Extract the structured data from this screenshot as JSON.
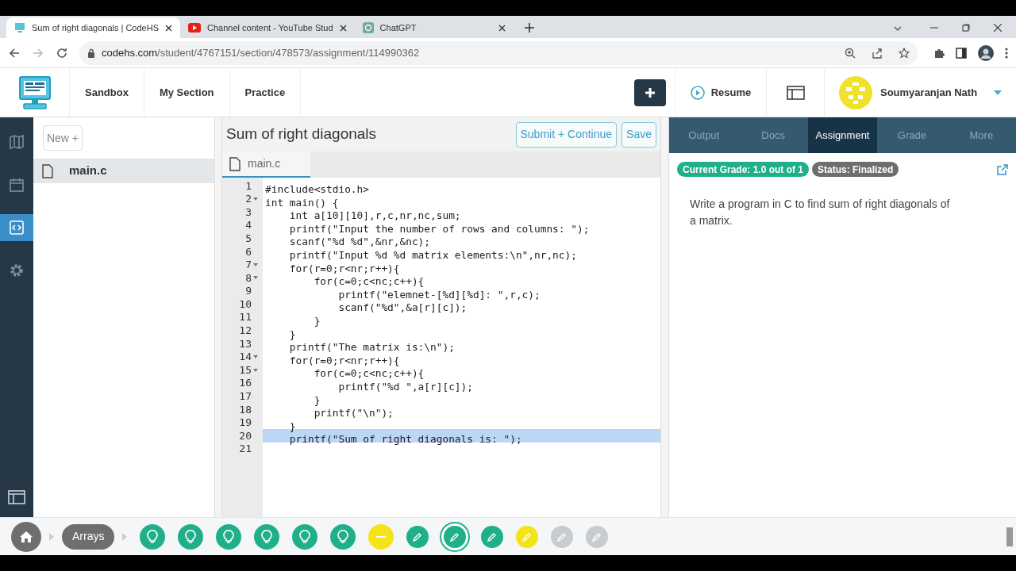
{
  "browser": {
    "tabs": [
      {
        "title": "Sum of right diagonals | CodeHS",
        "selected": true,
        "kind": "codehs"
      },
      {
        "title": "Channel content - YouTube Stud",
        "selected": false,
        "kind": "youtube"
      },
      {
        "title": "ChatGPT",
        "selected": false,
        "kind": "chatgpt"
      }
    ],
    "url_host": "codehs.com",
    "url_path": "/student/4767151/section/478573/assignment/114990362"
  },
  "nav": {
    "items": [
      "Sandbox",
      "My Section",
      "Practice"
    ],
    "resume": "Resume",
    "user": "Soumyaranjan Nath"
  },
  "rail": [
    {
      "kind": "map",
      "selected": false
    },
    {
      "kind": "calendar",
      "selected": false
    },
    {
      "kind": "code",
      "selected": true
    },
    {
      "kind": "gear",
      "selected": false
    }
  ],
  "files": {
    "new_button": "New +",
    "items": [
      {
        "name": "main.c",
        "selected": true
      }
    ]
  },
  "editor": {
    "title": "Sum of right diagonals",
    "buttons": [
      "Submit + Continue",
      "Save"
    ],
    "tab": "main.c",
    "lines": [
      {
        "num": "1",
        "text": "#include<stdio.h>",
        "foldable": false,
        "highlighted": false
      },
      {
        "num": "2",
        "text": "int main() {",
        "foldable": true,
        "highlighted": false
      },
      {
        "num": "3",
        "text": "    int a[10][10],r,c,nr,nc,sum;",
        "foldable": false,
        "highlighted": false
      },
      {
        "num": "4",
        "text": "    printf(\"Input the number of rows and columns: \");",
        "foldable": false,
        "highlighted": false
      },
      {
        "num": "5",
        "text": "    scanf(\"%d %d\",&nr,&nc);",
        "foldable": false,
        "highlighted": false
      },
      {
        "num": "6",
        "text": "    printf(\"Input %d %d matrix elements:\\n\",nr,nc);",
        "foldable": false,
        "highlighted": false
      },
      {
        "num": "7",
        "text": "    for(r=0;r<nr;r++){",
        "foldable": true,
        "highlighted": false
      },
      {
        "num": "8",
        "text": "        for(c=0;c<nc;c++){",
        "foldable": true,
        "highlighted": false
      },
      {
        "num": "9",
        "text": "            printf(\"elemnet-[%d][%d]: \",r,c);",
        "foldable": false,
        "highlighted": false
      },
      {
        "num": "10",
        "text": "            scanf(\"%d\",&a[r][c]);",
        "foldable": false,
        "highlighted": false
      },
      {
        "num": "11",
        "text": "        }",
        "foldable": false,
        "highlighted": false
      },
      {
        "num": "12",
        "text": "    }",
        "foldable": false,
        "highlighted": false
      },
      {
        "num": "13",
        "text": "    printf(\"The matrix is:\\n\");",
        "foldable": false,
        "highlighted": false
      },
      {
        "num": "14",
        "text": "    for(r=0;r<nr;r++){",
        "foldable": true,
        "highlighted": false
      },
      {
        "num": "15",
        "text": "        for(c=0;c<nc;c++){",
        "foldable": true,
        "highlighted": false
      },
      {
        "num": "16",
        "text": "            printf(\"%d \",a[r][c]);",
        "foldable": false,
        "highlighted": false
      },
      {
        "num": "17",
        "text": "        }",
        "foldable": false,
        "highlighted": false
      },
      {
        "num": "18",
        "text": "        printf(\"\\n\");",
        "foldable": false,
        "highlighted": false
      },
      {
        "num": "19",
        "text": "    }",
        "foldable": false,
        "highlighted": false
      },
      {
        "num": "20",
        "text": "    printf(\"Sum of right diagonals is: \");",
        "foldable": false,
        "highlighted": true
      },
      {
        "num": "21",
        "foldable": false,
        "highlighted": false
      }
    ]
  },
  "panel": {
    "tabs": [
      {
        "label": "Output",
        "selected": false
      },
      {
        "label": "Docs",
        "selected": false
      },
      {
        "label": "Assignment",
        "selected": true
      },
      {
        "label": "Grade",
        "selected": false
      },
      {
        "label": "More",
        "selected": false
      }
    ],
    "badges": [
      {
        "text": "Current Grade: 1.0 out of 1",
        "color": "#1fb08a"
      },
      {
        "text": "Status: Finalized",
        "color": "#6d6e70"
      }
    ],
    "description": "Write a program in C to find sum of right diagonals of a matrix."
  },
  "progress": {
    "unit": "Arrays",
    "items": [
      {
        "kind": "bulb",
        "color": "#1fb08a",
        "selected": false
      },
      {
        "kind": "bulb",
        "color": "#1fb08a",
        "selected": false
      },
      {
        "kind": "bulb",
        "color": "#1fb08a",
        "selected": false
      },
      {
        "kind": "bulb",
        "color": "#1fb08a",
        "selected": false
      },
      {
        "kind": "bulb",
        "color": "#1fb08a",
        "selected": false
      },
      {
        "kind": "bulb",
        "color": "#1fb08a",
        "selected": false
      },
      {
        "kind": "dash",
        "color": "#f5e31a",
        "selected": false
      },
      {
        "kind": "pencil",
        "color": "#1fb08a",
        "selected": false
      },
      {
        "kind": "pencil",
        "color": "#1fb08a",
        "selected": true
      },
      {
        "kind": "pencil",
        "color": "#1fb08a",
        "selected": false
      },
      {
        "kind": "pencil",
        "color": "#f5e31a",
        "selected": false
      },
      {
        "kind": "pencil",
        "color": "#c9cccf",
        "selected": false
      },
      {
        "kind": "pencil",
        "color": "#c9cccf",
        "selected": false
      }
    ]
  }
}
